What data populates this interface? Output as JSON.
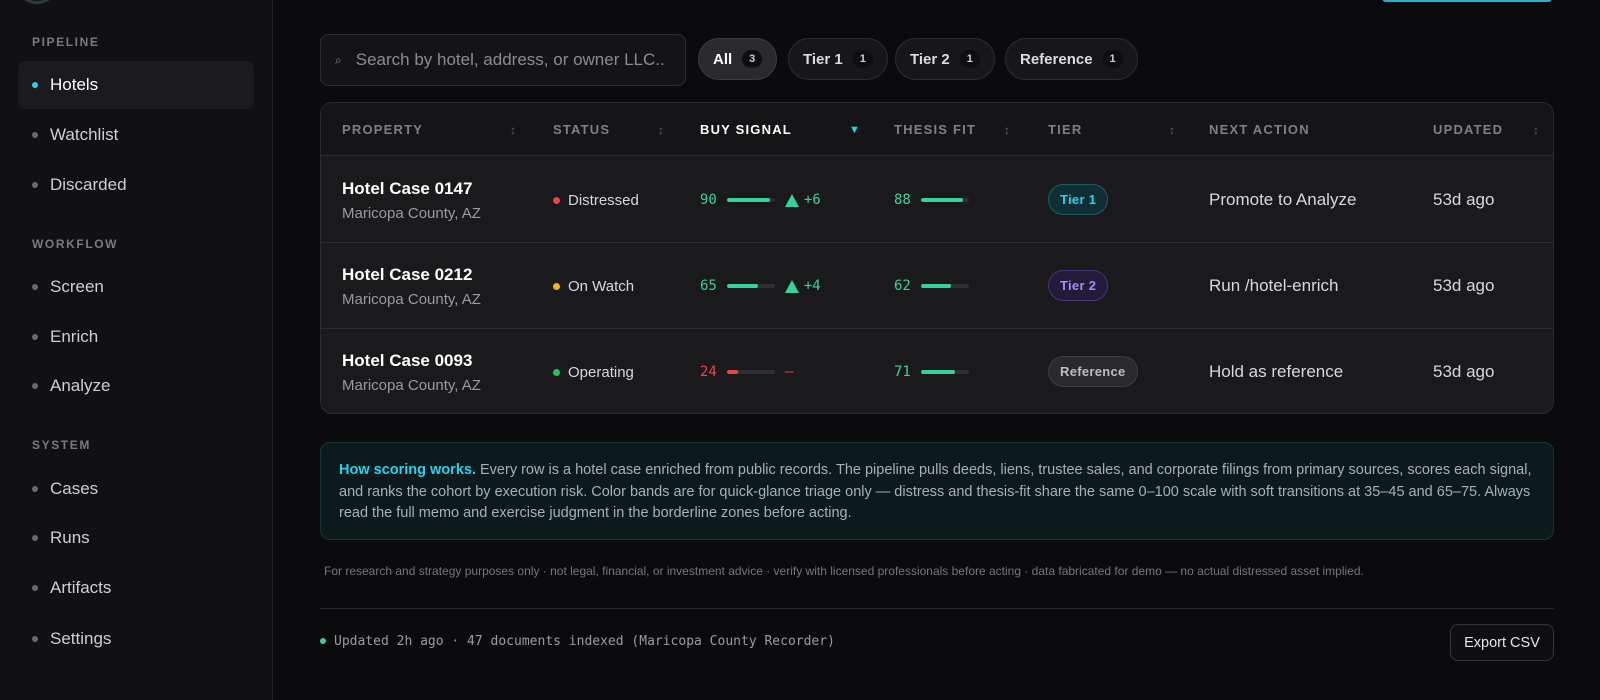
{
  "sidebar": {
    "sections": [
      {
        "label": "PIPELINE",
        "items": [
          {
            "label": "Hotels",
            "active": true
          },
          {
            "label": "Watchlist",
            "active": false
          },
          {
            "label": "Discarded",
            "active": false
          }
        ]
      },
      {
        "label": "WORKFLOW",
        "items": [
          {
            "label": "Screen",
            "active": false
          },
          {
            "label": "Enrich",
            "active": false
          },
          {
            "label": "Analyze",
            "active": false
          }
        ]
      },
      {
        "label": "SYSTEM",
        "items": [
          {
            "label": "Cases",
            "active": false
          },
          {
            "label": "Runs",
            "active": false
          },
          {
            "label": "Artifacts",
            "active": false
          },
          {
            "label": "Settings",
            "active": false
          }
        ]
      }
    ]
  },
  "search": {
    "placeholder": "Search by hotel, address, or owner LLC...",
    "icon": "search-icon"
  },
  "filters": [
    {
      "label": "All",
      "count": "3",
      "active": true
    },
    {
      "label": "Tier 1",
      "count": "1",
      "active": false
    },
    {
      "label": "Tier 2",
      "count": "1",
      "active": false
    },
    {
      "label": "Reference",
      "count": "1",
      "active": false
    }
  ],
  "table": {
    "columns": {
      "property": "PROPERTY",
      "status": "STATUS",
      "buy_signal": "BUY SIGNAL",
      "thesis_fit": "THESIS FIT",
      "tier": "TIER",
      "next_action": "NEXT ACTION",
      "updated": "UPDATED"
    },
    "sorted_column": "buy_signal",
    "rows": [
      {
        "name": "Hotel Case 0147",
        "location": "Maricopa County, AZ",
        "status": "Distressed",
        "status_color": "#ef4444",
        "buy_signal": "90",
        "buy_signal_value": 90,
        "buy_signal_color": "#34d399",
        "delta": "+6",
        "delta_up": true,
        "thesis_fit": "88",
        "thesis_fit_value": 88,
        "thesis_fit_color": "#34d399",
        "tier": "Tier 1",
        "tier_style": "tier1",
        "next_action": "Promote to Analyze",
        "updated": "53d ago"
      },
      {
        "name": "Hotel Case 0212",
        "location": "Maricopa County, AZ",
        "status": "On Watch",
        "status_color": "#f5b50a",
        "buy_signal": "65",
        "buy_signal_value": 65,
        "buy_signal_color": "#34d399",
        "delta": "+4",
        "delta_up": true,
        "thesis_fit": "62",
        "thesis_fit_value": 62,
        "thesis_fit_color": "#34d399",
        "tier": "Tier 2",
        "tier_style": "tier2",
        "next_action": "Run /hotel-enrich",
        "updated": "53d ago"
      },
      {
        "name": "Hotel Case 0093",
        "location": "Maricopa County, AZ",
        "status": "Operating",
        "status_color": "#22c55e",
        "buy_signal": "24",
        "buy_signal_value": 24,
        "buy_signal_color": "#ef4444",
        "delta": "–",
        "delta_up": false,
        "thesis_fit": "71",
        "thesis_fit_value": 71,
        "thesis_fit_color": "#34d399",
        "tier": "Reference",
        "tier_style": "reference",
        "next_action": "Hold as reference",
        "updated": "53d ago"
      }
    ]
  },
  "info": {
    "title": "How scoring works.",
    "body": " Every row is a hotel case enriched from public records. The pipeline pulls deeds, liens, trustee sales, and corporate filings from primary sources, scores each signal, and ranks the cohort by execution risk. Color bands are for quick-glance triage only — distress and thesis-fit share the same 0–100 scale with soft transitions at 35–45 and 65–75. Always read the full memo and exercise judgment in the borderline zones before acting."
  },
  "disclaimer": "For research and strategy purposes only · not legal, financial, or investment advice · verify with licensed professionals before acting · data fabricated for demo — no actual distressed asset implied.",
  "footer": {
    "status": "Updated 2h ago · 47 documents indexed (Maricopa County Recorder)",
    "export_label": "Export CSV"
  },
  "colors": {
    "accent": "#22d3ee",
    "positive": "#34d399",
    "negative": "#ef4444"
  }
}
